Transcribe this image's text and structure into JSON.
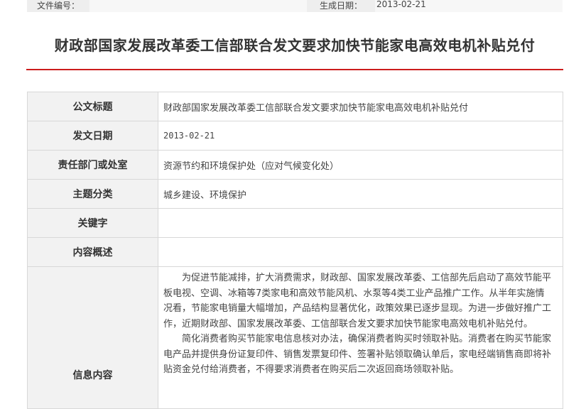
{
  "meta": {
    "file_no_label": "文件编号：",
    "file_no_value": "",
    "date_label": "生成日期：",
    "date_value": "2013-02-21"
  },
  "title": "财政部国家发展改革委工信部联合发文要求加快节能家电高效电机补贴兑付",
  "rows": [
    {
      "label": "公文标题",
      "value": "财政部国家发展改革委工信部联合发文要求加快节能家电高效电机补贴兑付"
    },
    {
      "label": "发文日期",
      "value": "2013-02-21"
    },
    {
      "label": "责任部门或处室",
      "value": "资源节约和环境保护处（应对气候变化处）"
    },
    {
      "label": "主题分类",
      "value": "城乡建设、环境保护"
    },
    {
      "label": "关键字",
      "value": ""
    },
    {
      "label": "内容概述",
      "value": ""
    }
  ],
  "content": {
    "label": "信息内容",
    "paragraphs": [
      "为促进节能减排，扩大消费需求，财政部、国家发展改革委、工信部先后启动了高效节能平板电视、空调、冰箱等7类家电和高效节能风机、水泵等4类工业产品推广工作。从半年实施情况看，节能家电销量大幅增加，产品结构显著优化，政策效果已逐步显现。为进一步做好推广工作，近期财政部、国家发展改革委、工信部联合发文要求加快节能家电高效电机补贴兑付。",
      "简化消费者购买节能家电信息核对办法，确保消费者购买时领取补贴。消费者在购买节能家电产品并提供身份证复印件、销售发票复印件、签署补贴领取确认单后，家电经端销售商即将补贴资金兑付给消费者，不得要求消费者在购买后二次返回商场领取补贴。"
    ]
  }
}
